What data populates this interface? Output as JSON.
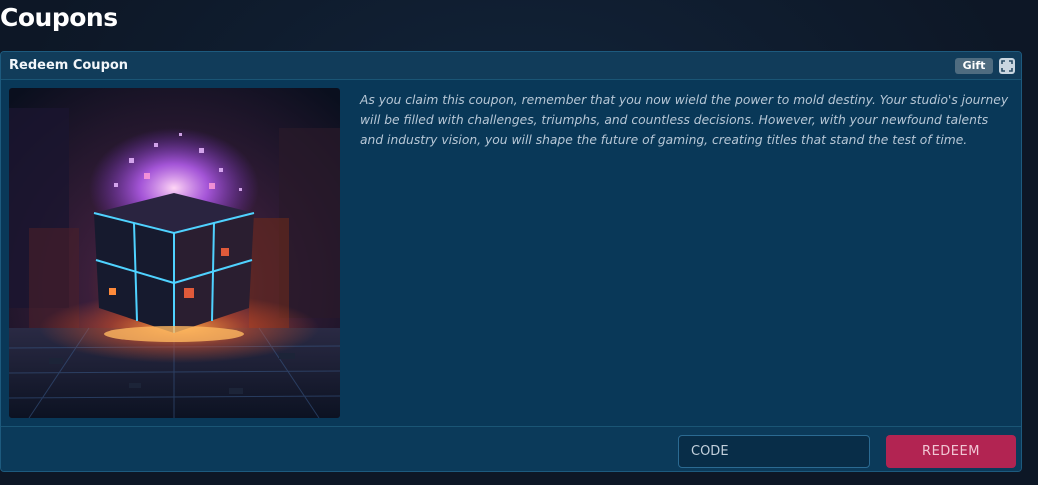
{
  "page": {
    "title": "Coupons"
  },
  "card": {
    "title": "Redeem Coupon",
    "badge": "Gift",
    "expand_icon": "expand-icon",
    "image_subject": "gift-cube-illustration",
    "description": "As you claim this coupon, remember that you now wield the power to mold destiny. Your studio's journey will be filled with challenges, triumphs, and countless decisions. However, with your newfound talents and industry vision, you will shape the future of gaming, creating titles that stand the test of time."
  },
  "form": {
    "code_placeholder": "CODE",
    "code_value": "",
    "redeem_label": "REDEEM"
  },
  "colors": {
    "accent": "#b22452",
    "card_background": "#093858",
    "page_background": "#0e1a2b",
    "badge": "#4f6c80"
  }
}
